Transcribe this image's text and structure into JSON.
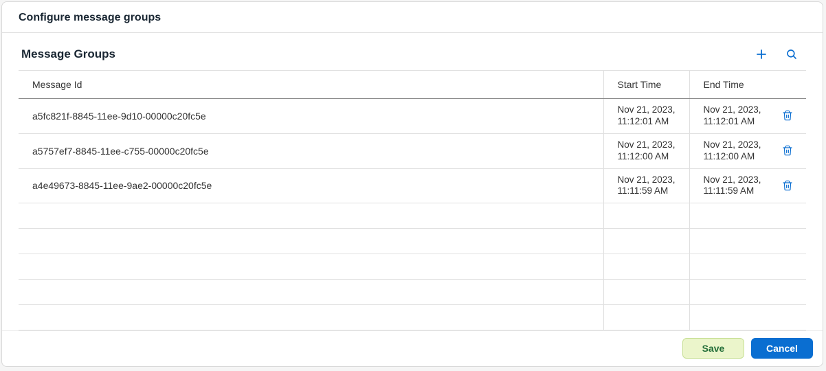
{
  "dialog": {
    "title": "Configure message groups"
  },
  "section": {
    "title": "Message Groups"
  },
  "table": {
    "headers": {
      "id": "Message Id",
      "start": "Start Time",
      "end": "End Time"
    },
    "rows": [
      {
        "id": "a5fc821f-8845-11ee-9d10-00000c20fc5e",
        "start": "Nov 21, 2023, 11:12:01 AM",
        "end": "Nov 21, 2023, 11:12:01 AM"
      },
      {
        "id": "a5757ef7-8845-11ee-c755-00000c20fc5e",
        "start": "Nov 21, 2023, 11:12:00 AM",
        "end": "Nov 21, 2023, 11:12:00 AM"
      },
      {
        "id": "a4e49673-8845-11ee-9ae2-00000c20fc5e",
        "start": "Nov 21, 2023, 11:11:59 AM",
        "end": "Nov 21, 2023, 11:11:59 AM"
      }
    ]
  },
  "footer": {
    "save": "Save",
    "cancel": "Cancel"
  }
}
